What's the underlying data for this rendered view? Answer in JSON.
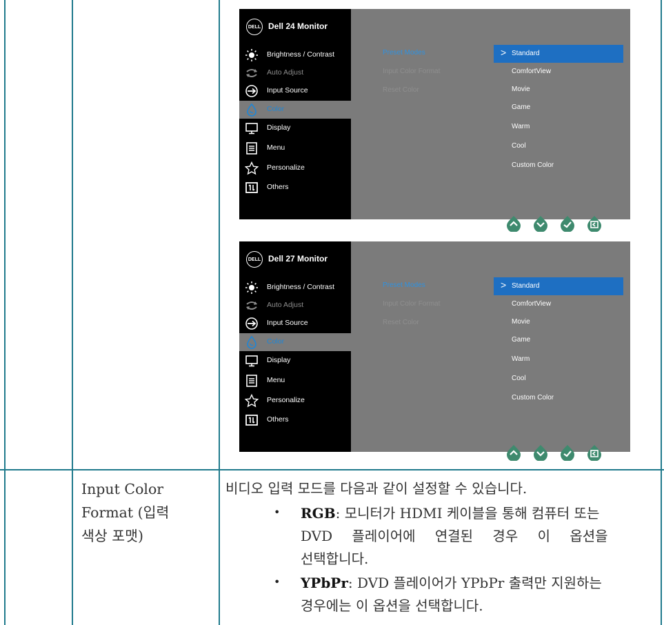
{
  "monitors": [
    {
      "logo": "DELL",
      "title": "Dell 24 Monitor",
      "menu": [
        {
          "icon": "brightness-icon",
          "label": "Brightness / Contrast",
          "state": "normal"
        },
        {
          "icon": "auto-adjust-icon",
          "label": "Auto Adjust",
          "state": "dim"
        },
        {
          "icon": "input-source-icon",
          "label": "Input Source",
          "state": "normal"
        },
        {
          "icon": "color-drop-icon",
          "label": "Color",
          "state": "active"
        },
        {
          "icon": "display-icon",
          "label": "Display",
          "state": "normal"
        },
        {
          "icon": "menu-icon",
          "label": "Menu",
          "state": "normal"
        },
        {
          "icon": "star-icon",
          "label": "Personalize",
          "state": "normal"
        },
        {
          "icon": "others-icon",
          "label": "Others",
          "state": "normal"
        }
      ],
      "submenu": [
        {
          "label": "Preset Modes",
          "state": "selected"
        },
        {
          "label": "Input Color Format",
          "state": "dim"
        },
        {
          "label": "Reset Color",
          "state": "dim"
        }
      ],
      "options": [
        "Standard",
        "ComfortView",
        "Movie",
        "Game",
        "Warm",
        "Cool",
        "Custom Color"
      ],
      "selected_option": "Standard"
    },
    {
      "logo": "DELL",
      "title": "Dell 27 Monitor",
      "menu": [
        {
          "icon": "brightness-icon",
          "label": "Brightness / Contrast",
          "state": "normal"
        },
        {
          "icon": "auto-adjust-icon",
          "label": "Auto Adjust",
          "state": "dim"
        },
        {
          "icon": "input-source-icon",
          "label": "Input Source",
          "state": "normal"
        },
        {
          "icon": "color-drop-icon",
          "label": "Color",
          "state": "active"
        },
        {
          "icon": "display-icon",
          "label": "Display",
          "state": "normal"
        },
        {
          "icon": "menu-icon",
          "label": "Menu",
          "state": "normal"
        },
        {
          "icon": "star-icon",
          "label": "Personalize",
          "state": "normal"
        },
        {
          "icon": "others-icon",
          "label": "Others",
          "state": "normal"
        }
      ],
      "submenu": [
        {
          "label": "Preset Modes",
          "state": "selected"
        },
        {
          "label": "Input Color Format",
          "state": "dim"
        },
        {
          "label": "Reset Color",
          "state": "dim"
        }
      ],
      "options": [
        "Standard",
        "ComfortView",
        "Movie",
        "Game",
        "Warm",
        "Cool",
        "Custom Color"
      ],
      "selected_option": "Standard"
    }
  ],
  "nav_buttons": [
    "up-arrow-icon",
    "down-arrow-icon",
    "check-icon",
    "back-icon"
  ],
  "row2": {
    "label_line1": "Input Color",
    "label_line2": "Format (입력",
    "label_line3": "색상 포맷)",
    "intro": "비디오 입력 모드를 다음과 같이 설정할 수 있습니다.",
    "bullet_char": "•",
    "bullets": [
      {
        "term": "RGB",
        "line1": ": 모니터가 HDMI 케이블을 통해 컴퓨터 또는",
        "line2": "DVD 플레이어에 연결된 경우 이 옵션을",
        "line3": "선택합니다."
      },
      {
        "term": "YPbPr",
        "line1": ": DVD 플레이어가 YPbPr 출력만 지원하는",
        "line2": "경우에는 이 옵션을 선택합니다."
      }
    ]
  },
  "colors": {
    "rule": "#1f7a8c",
    "osd_bg": "#7b7b7b",
    "osd_left": "#000000",
    "highlight": "#1e6fc2",
    "active_text": "#1e86d6",
    "nav_button": "#3e8a6e"
  }
}
